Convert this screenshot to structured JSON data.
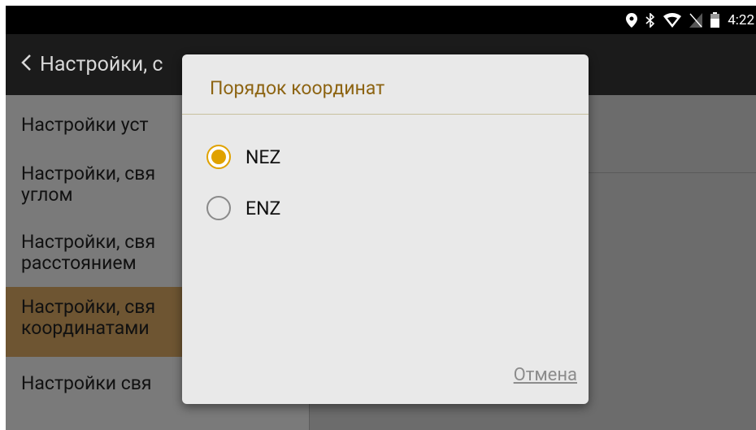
{
  "status_bar": {
    "time": "4:22",
    "icons": [
      "location-icon",
      "bluetooth-icon",
      "wifi-icon",
      "no-sim-icon",
      "battery-icon"
    ]
  },
  "action_bar": {
    "title": "Настройки, с"
  },
  "settings_list": {
    "items": [
      {
        "label_line1": "Настройки уст",
        "label_line2": ""
      },
      {
        "label_line1": "Настройки, свя",
        "label_line2": "углом"
      },
      {
        "label_line1": "Настройки, свя",
        "label_line2": "расстоянием"
      },
      {
        "label_line1": "Настройки, свя",
        "label_line2": "координатами",
        "selected": true
      },
      {
        "label_line1": "Настройки свя",
        "label_line2": ""
      }
    ]
  },
  "dialog": {
    "title": "Порядок координат",
    "options": [
      {
        "label": "NEZ",
        "checked": true
      },
      {
        "label": "ENZ",
        "checked": false
      }
    ],
    "cancel_label": "Отмена"
  },
  "colors": {
    "accent": "#e0a200",
    "title": "#8d6412",
    "selected_row": "#6e5532"
  }
}
